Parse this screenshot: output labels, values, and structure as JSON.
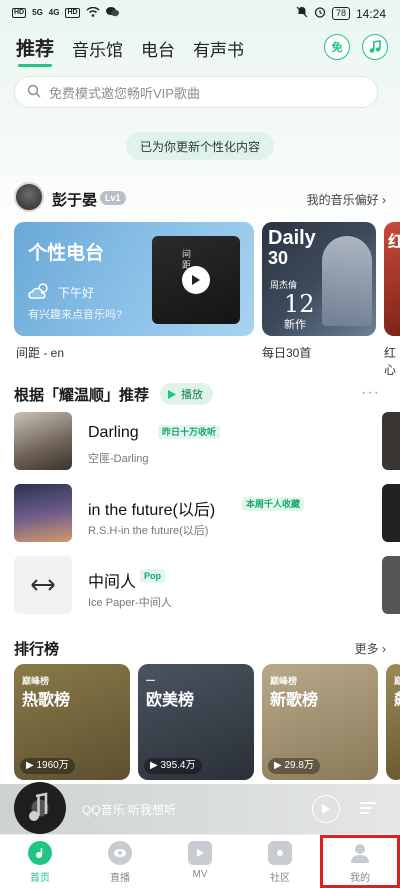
{
  "status_bar": {
    "left_labels": [
      "HD",
      "5G",
      "4G",
      "HD"
    ],
    "battery": "78",
    "time": "14:24"
  },
  "top_tabs": [
    "推荐",
    "音乐馆",
    "电台",
    "有声书"
  ],
  "top_icons": {
    "free_label": "免",
    "music_icon": "music-note-icon"
  },
  "search": {
    "placeholder": "免费模式邀您畅听VIP歌曲"
  },
  "update_notice": "已为你更新个性化内容",
  "user": {
    "name": "彭于晏",
    "level": "Lv1",
    "preferences": "我的音乐偏好"
  },
  "cards": {
    "radio": {
      "title": "个性电台",
      "greeting": "下午好",
      "prompt": "有兴趣来点音乐吗?",
      "caption": "间距 - en",
      "album_text": "间\n距"
    },
    "daily": {
      "title": "Daily",
      "number": "30",
      "artist": "周杰倫",
      "big": "12",
      "sub": "新作",
      "caption": "每日30首"
    },
    "peek": {
      "title": "红",
      "caption": "红心"
    }
  },
  "recommend": {
    "heading": "根据「耀温顺」推荐",
    "play_label": "播放",
    "songs": [
      {
        "title": "Darling",
        "tag": "昨日十万收听",
        "subtitle": "空匪-Darling"
      },
      {
        "title": "in the future(以后)",
        "tag": "本周千人收藏",
        "subtitle": "R.S.H-in the future(以后)"
      },
      {
        "title": "中间人",
        "tag": "Pop",
        "subtitle": "Ice Paper-中间人"
      }
    ]
  },
  "charts": {
    "heading": "排行榜",
    "more": "更多",
    "items": [
      {
        "brand": "巅峰榜",
        "name": "热歌榜",
        "count": "1960万"
      },
      {
        "brand": "一",
        "name": "欧美榜",
        "count": "395.4万"
      },
      {
        "brand": "巅峰榜",
        "name": "新歌榜",
        "count": "29.8万"
      },
      {
        "brand": "巅",
        "name": "飙",
        "count": ""
      }
    ],
    "peek_caption": "飙升"
  },
  "mini_player": {
    "text": "QQ音乐 听我想听"
  },
  "bottom_nav": [
    {
      "label": "首页",
      "icon": "home-icon"
    },
    {
      "label": "直播",
      "icon": "live-eye-icon"
    },
    {
      "label": "MV",
      "icon": "mv-play-icon"
    },
    {
      "label": "社区",
      "icon": "community-icon"
    },
    {
      "label": "我的",
      "icon": "profile-icon"
    }
  ],
  "colors": {
    "accent": "#1fc583",
    "highlight_box": "#e21e1e"
  }
}
